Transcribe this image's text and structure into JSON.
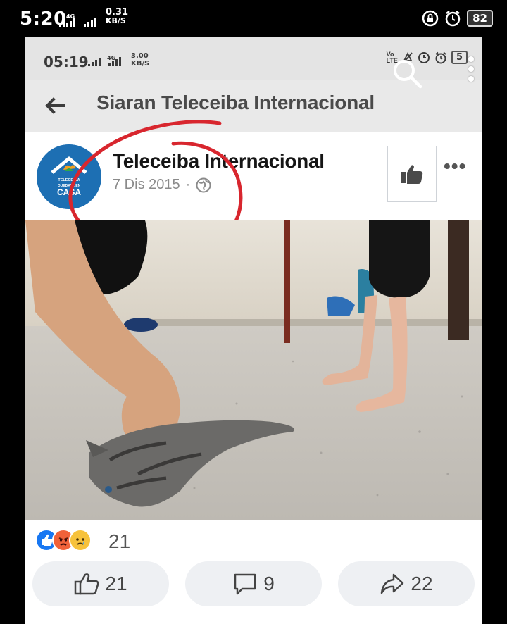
{
  "outer_status": {
    "time": "5:20",
    "network_top": "4G",
    "speed_value": "0.31",
    "speed_unit": "KB/S",
    "battery": "82"
  },
  "inner_status": {
    "time": "05:19",
    "network_top": "4G",
    "speed_value": "3.00",
    "speed_unit": "KB/S",
    "volte_top": "Vo",
    "volte_bottom": "LTE",
    "battery": "5"
  },
  "header": {
    "title": "Siaran Teleceiba Internacional"
  },
  "post": {
    "author": "Teleceiba Internacional",
    "date": "7 Dis 2015",
    "separator": "·",
    "avatar_text_top": "TELECEIBA",
    "avatar_text_mid": "QUEDATE EN",
    "avatar_text_bottom": "CASA",
    "reaction_count": "21"
  },
  "actions": {
    "likes": "21",
    "comments": "9",
    "shares": "22"
  },
  "colors": {
    "annotation_red": "#d8262e",
    "like_blue": "#1877f2",
    "angry_orange": "#f0623a",
    "sad_yellow": "#f7c23a"
  }
}
